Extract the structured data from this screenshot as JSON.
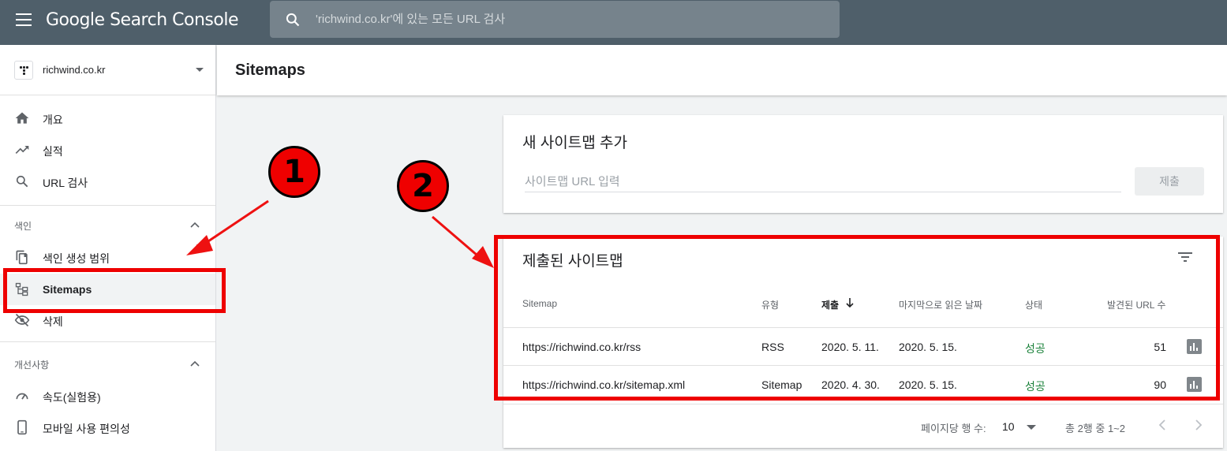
{
  "header": {
    "title": "Google Search Console",
    "search_placeholder": "'richwind.co.kr'에 있는 모든 URL 검사"
  },
  "sidebar": {
    "property": "richwind.co.kr",
    "items": [
      {
        "label": "개요",
        "icon": "home-icon"
      },
      {
        "label": "실적",
        "icon": "trending-up-icon"
      },
      {
        "label": "URL 검사",
        "icon": "search-icon"
      }
    ],
    "index_section": {
      "title": "색인",
      "items": [
        {
          "label": "색인 생성 범위",
          "icon": "file-copy-icon"
        },
        {
          "label": "Sitemaps",
          "icon": "sitemap-icon",
          "active": true
        },
        {
          "label": "삭제",
          "icon": "visibility-off-icon"
        }
      ]
    },
    "enhancements_section": {
      "title": "개선사항",
      "items": [
        {
          "label": "속도(실험용)",
          "icon": "speed-icon"
        },
        {
          "label": "모바일 사용 편의성",
          "icon": "smartphone-icon"
        }
      ]
    }
  },
  "main": {
    "page_title": "Sitemaps",
    "add_card": {
      "title": "새 사이트맵 추가",
      "input_placeholder": "사이트맵 URL 입력",
      "submit_label": "제출"
    },
    "submitted_card": {
      "title": "제출된 사이트맵",
      "columns": [
        "Sitemap",
        "유형",
        "제출",
        "마지막으로 읽은 날짜",
        "상태",
        "발견된 URL 수"
      ],
      "rows": [
        {
          "sitemap": "https://richwind.co.kr/rss",
          "type": "RSS",
          "submitted": "2020. 5. 11.",
          "last_read": "2020. 5. 15.",
          "status": "성공",
          "urls": "51"
        },
        {
          "sitemap": "https://richwind.co.kr/sitemap.xml",
          "type": "Sitemap",
          "submitted": "2020. 4. 30.",
          "last_read": "2020. 5. 15.",
          "status": "성공",
          "urls": "90"
        }
      ],
      "footer": {
        "rows_per_page_label": "페이지당 행 수:",
        "rows_per_page": "10",
        "range": "총 2행 중 1~2"
      }
    }
  },
  "annotations": {
    "badge1": "1",
    "badge2": "2",
    "color": "#ee0000"
  },
  "colors": {
    "topbar": "#4f5f6a",
    "status_success": "#188038"
  }
}
